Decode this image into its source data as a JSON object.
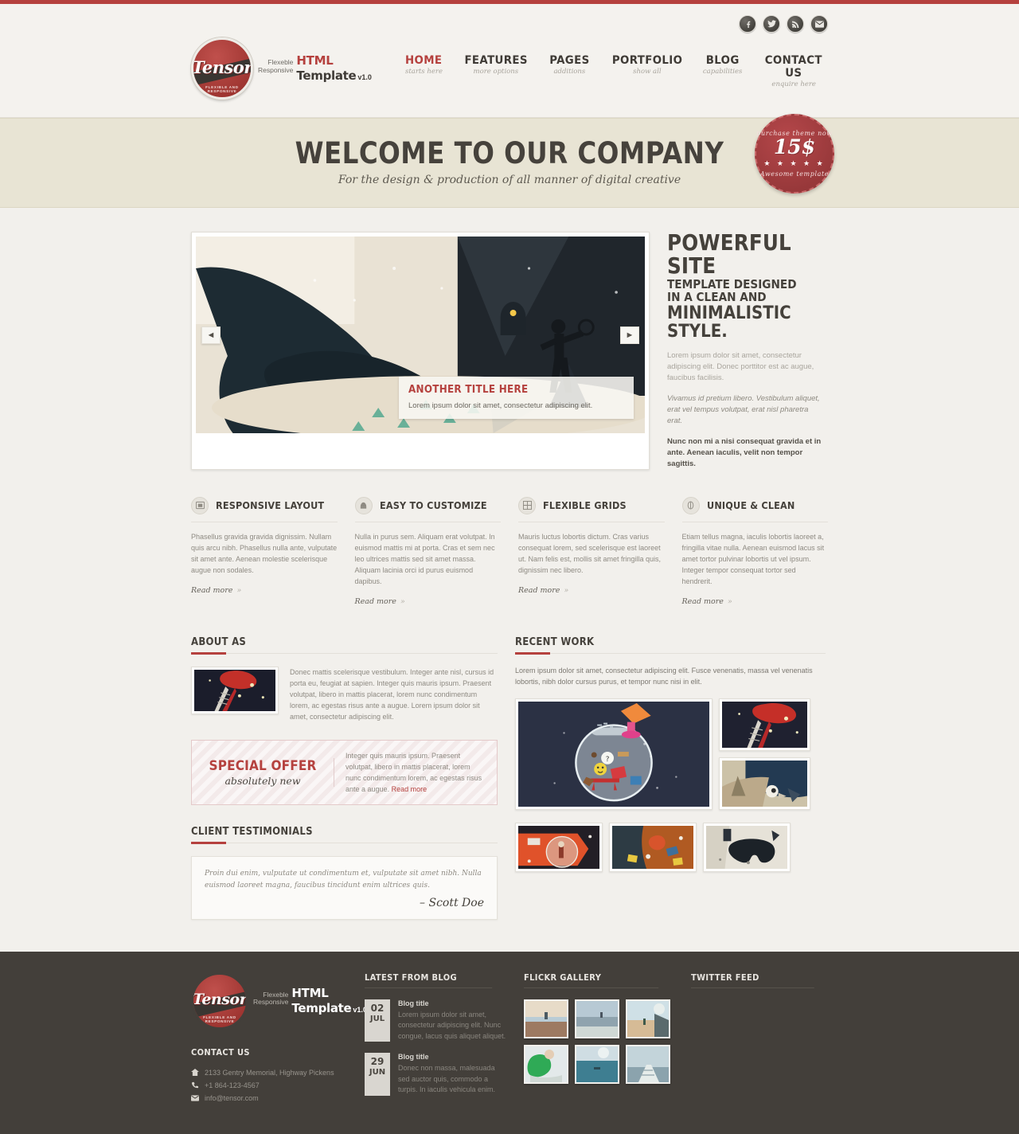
{
  "theme": {
    "accent_red": "#b5413e",
    "dark_text": "#45413b",
    "banner_bg": "#e8e4d4",
    "footer_bg": "#433f3a"
  },
  "header": {
    "social": [
      {
        "name": "facebook-icon",
        "glyph": "f"
      },
      {
        "name": "twitter-icon",
        "glyph": "t"
      },
      {
        "name": "rss-icon",
        "glyph": "r"
      },
      {
        "name": "email-icon",
        "glyph": "m"
      }
    ],
    "logo": {
      "word": "Tensor",
      "sub": "FLEXIBLE AND RESPONSIVE",
      "tagline_line1": "Flexeble",
      "tagline_line2": "Responsive",
      "title_red": "HTML",
      "title_dark": " Template",
      "version": "v1.0"
    },
    "nav": [
      {
        "label": "HOME",
        "sub": "starts here",
        "active": true
      },
      {
        "label": "FEATURES",
        "sub": "more options",
        "active": false
      },
      {
        "label": "PAGES",
        "sub": "additions",
        "active": false
      },
      {
        "label": "PORTFOLIO",
        "sub": "show all",
        "active": false
      },
      {
        "label": "BLOG",
        "sub": "capabilities",
        "active": false
      },
      {
        "label": "CONTACT US",
        "sub": "enquire here",
        "active": false
      }
    ]
  },
  "banner": {
    "title": "WELCOME TO OUR COMPANY",
    "subtitle": "For the design & production of all manner of digital creative",
    "badge": {
      "top": "purchase theme now",
      "price": "15$",
      "stars": "★ ★ ★ ★ ★",
      "bottom": "Awesome template"
    }
  },
  "slider": {
    "prev_glyph": "◄",
    "next_glyph": "►",
    "caption_title": "ANOTHER TITLE HERE",
    "caption_text": "Lorem ipsum dolor sit amet, consectetur adipiscing elit."
  },
  "intro": {
    "line1": "POWERFUL SITE",
    "line2": "TEMPLATE DESIGNED IN A CLEAN AND",
    "line3": "MINIMALISTIC STYLE.",
    "para1": "Lorem ipsum dolor sit amet, consectetur adipiscing elit. Donec porttitor est ac augue, faucibus facilisis.",
    "para2": "Vivamus id pretium libero. Vestibulum aliquet, erat vel tempus volutpat, erat nisl pharetra erat.",
    "para3": "Nunc non mi a nisi consequat gravida et in ante. Aenean iaculis, velit non tempor sagittis."
  },
  "features": [
    {
      "icon": "image-icon",
      "title": "RESPONSIVE LAYOUT",
      "text": "Phasellus gravida gravida dignissim. Nullam quis arcu nibh. Phasellus nulla ante, vulputate sit amet ante. Aenean molestie scelerisque augue non sodales.",
      "readmore": "Read more"
    },
    {
      "icon": "brush-icon",
      "title": "EASY TO CUSTOMIZE",
      "text": "Nulla in purus sem. Aliquam erat volutpat. In euismod mattis mi at porta. Cras et sem nec leo ultrices mattis sed sit amet massa. Aliquam lacinia orci id purus euismod dapibus.",
      "readmore": "Read more"
    },
    {
      "icon": "grid-icon",
      "title": "FLEXIBLE GRIDS",
      "text": "Mauris luctus lobortis dictum. Cras varius consequat lorem, sed scelerisque est laoreet ut. Nam felis est, mollis sit amet fringilla quis, dignissim nec libero.",
      "readmore": "Read more"
    },
    {
      "icon": "leaf-icon",
      "title": "UNIQUE & CLEAN",
      "text": "Etiam tellus magna, iaculis lobortis laoreet a, fringilla vitae nulla. Aenean euismod lacus sit amet tortor pulvinar lobortis ut vel ipsum. Integer tempor consequat tortor sed hendrerit.",
      "readmore": "Read more"
    }
  ],
  "about": {
    "title": "ABOUT AS",
    "text": "Donec mattis scelerisque vestibulum. Integer ante nisl, cursus id porta eu, feugiat at sapien. Integer quis mauris ipsum. Praesent volutpat, libero in mattis placerat, lorem nunc condimentum lorem, ac egestas risus ante a augue. Lorem ipsum dolor sit amet, consectetur adipiscing elit."
  },
  "offer": {
    "title": "SPECIAL OFFER",
    "subtitle": "absolutely new",
    "text": "Integer quis mauris ipsum. Praesent volutpat, libero in mattis placerat, lorem nunc condimentum lorem, ac egestas risus ante a augue. ",
    "link": "Read more"
  },
  "testimonials": {
    "title": "CLIENT TESTIMONIALS",
    "quote": "Proin dui enim, vulputate ut condimentum et, vulputate sit amet nibh. Nulla euismod laoreet magna, faucibus tincidunt enim ultrices quis.",
    "author": "– Scott Doe"
  },
  "recent_work": {
    "title": "RECENT WORK",
    "text": "Lorem ipsum dolor sit amet, consectetur adipiscing elit. Fusce venenatis, massa vel venenatis lobortis, nibh dolor cursus purus, et tempor nunc nisi in elit."
  },
  "footer": {
    "contact_title": "CONTACT US",
    "address": "2133 Gentry Memorial, Highway Pickens",
    "phone": "+1 864-123-4567",
    "email": "info@tensor.com",
    "blog_title": "LATEST FROM BLOG",
    "blog_posts": [
      {
        "day": "02",
        "month": "JUL",
        "title": "Blog title",
        "excerpt": "Lorem ipsum dolor sit amet, consectetur adipiscing elit. Nunc congue, lacus quis aliquet aliquet."
      },
      {
        "day": "29",
        "month": "JUN",
        "title": "Blog title",
        "excerpt": "Donec non massa, malesuada sed auctor quis, commodo a turpis. In iaculis vehicula enim."
      }
    ],
    "flickr_title": "FLICKR GALLERY",
    "twitter_title": "TWITTER FEED"
  }
}
